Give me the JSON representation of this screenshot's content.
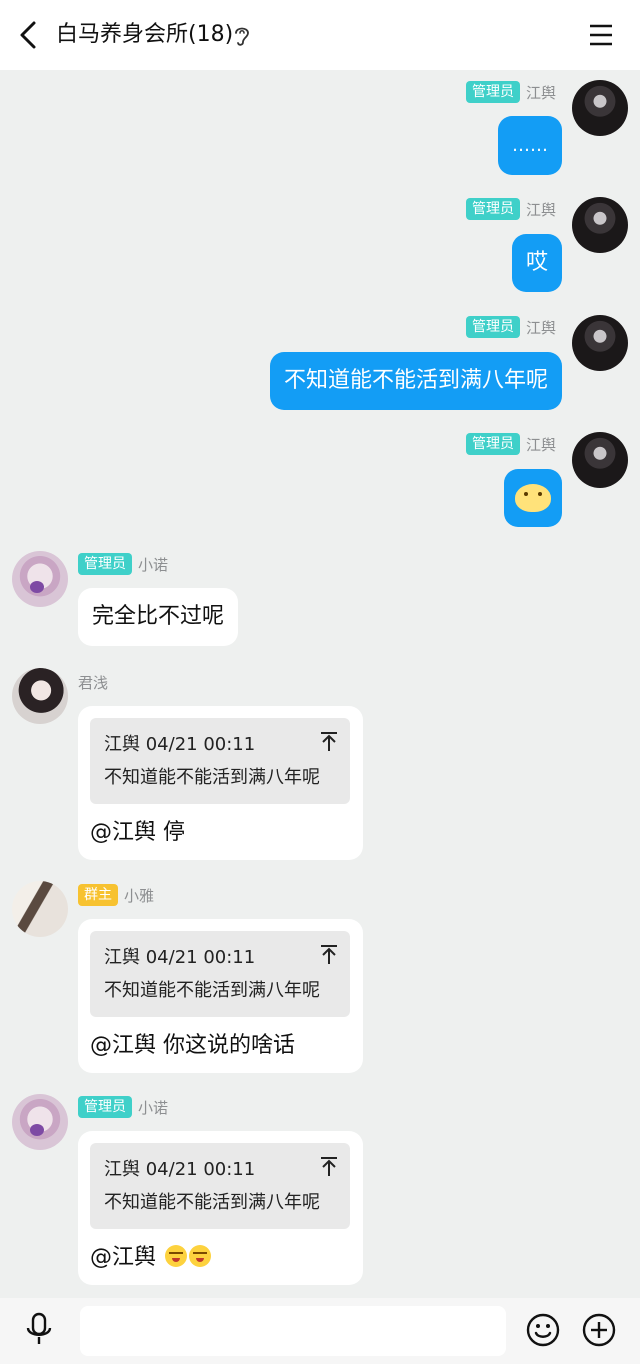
{
  "header": {
    "title": "白马养身会所(18)"
  },
  "messages": [
    {
      "side": "out",
      "badge": "管理员",
      "name": "江舆",
      "text": "……"
    },
    {
      "side": "out",
      "badge": "管理员",
      "name": "江舆",
      "text": "哎"
    },
    {
      "side": "out",
      "badge": "管理员",
      "name": "江舆",
      "text": "不知道能不能活到满八年呢"
    },
    {
      "side": "out",
      "badge": "管理员",
      "name": "江舆",
      "sticker": "smiling-sticker"
    },
    {
      "side": "in",
      "badge": "管理员",
      "name": "小诺",
      "text": "完全比不过呢"
    },
    {
      "side": "in",
      "name": "君浅",
      "quote": {
        "header": "江舆 04/21 00:11",
        "text": "不知道能不能活到满八年呢"
      },
      "reply": "@江舆 停"
    },
    {
      "side": "in",
      "badge": "群主",
      "name": "小雅",
      "quote": {
        "header": "江舆 04/21 00:11",
        "text": "不知道能不能活到满八年呢"
      },
      "reply": "@江舆 你这说的啥话"
    },
    {
      "side": "in",
      "badge": "管理员",
      "name": "小诺",
      "quote": {
        "header": "江舆 04/21 00:11",
        "text": "不知道能不能活到满八年呢"
      },
      "reply": "@江舆 ",
      "reply_emojis": [
        "grimace-emoji",
        "grimace-emoji"
      ]
    }
  ],
  "composer": {
    "placeholder": ""
  },
  "colors": {
    "outgoing_bubble": "#139df5",
    "admin_badge": "#3fd0c9",
    "owner_badge": "#f7c230"
  },
  "icons": [
    "back-arrow-icon",
    "ear-icon",
    "menu-icon",
    "mic-icon",
    "emoji-icon",
    "plus-icon"
  ]
}
